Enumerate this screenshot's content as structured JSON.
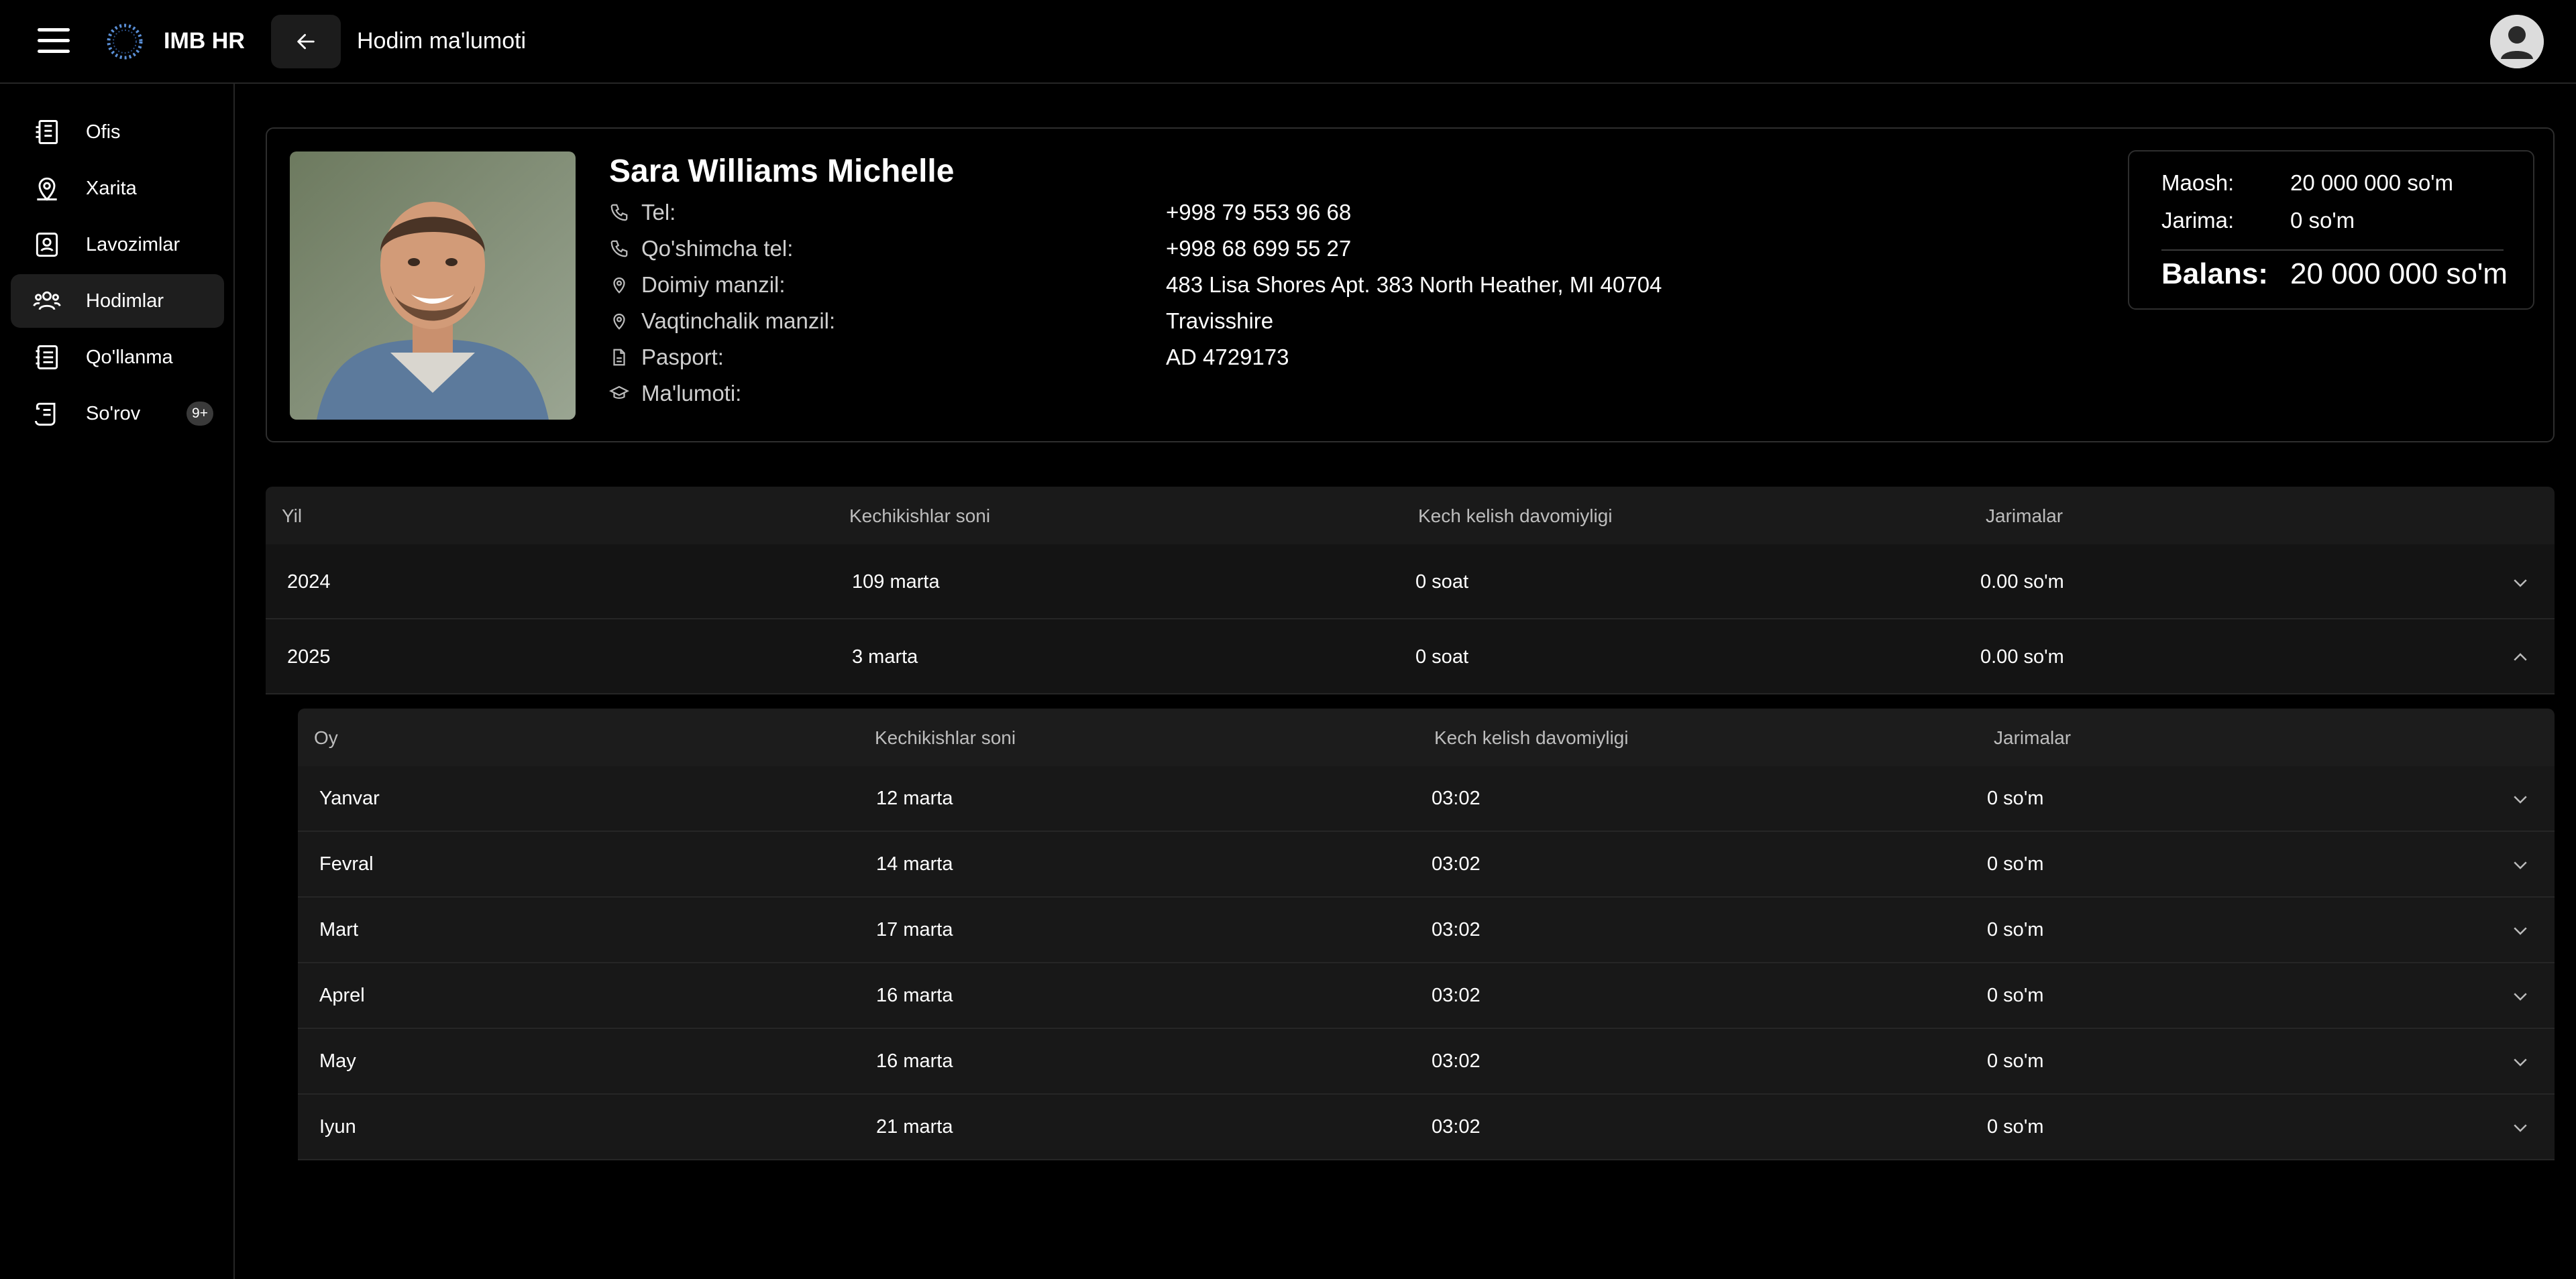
{
  "header": {
    "brand": "IMB HR",
    "page_title": "Hodim ma'lumoti"
  },
  "sidebar": {
    "items": [
      {
        "label": "Ofis",
        "icon": "office-building-icon"
      },
      {
        "label": "Xarita",
        "icon": "map-pin-icon"
      },
      {
        "label": "Lavozimlar",
        "icon": "id-badge-icon"
      },
      {
        "label": "Hodimlar",
        "icon": "users-icon",
        "active": true
      },
      {
        "label": "Qo'llanma",
        "icon": "notebook-icon"
      },
      {
        "label": "So'rov",
        "icon": "request-scroll-icon",
        "badge": "9+"
      }
    ]
  },
  "profile": {
    "name": "Sara Williams Michelle",
    "fields": [
      {
        "label": "Tel:",
        "value": "+998 79 553 96 68",
        "icon": "phone-icon"
      },
      {
        "label": "Qo'shimcha tel:",
        "value": "+998 68 699 55 27",
        "icon": "phone-icon"
      },
      {
        "label": "Doimiy manzil:",
        "value": "483 Lisa Shores Apt. 383 North Heather, MI 40704",
        "icon": "location-icon"
      },
      {
        "label": "Vaqtinchalik manzil:",
        "value": "Travisshire",
        "icon": "location-icon"
      },
      {
        "label": "Pasport:",
        "value": "AD 4729173",
        "icon": "document-icon"
      },
      {
        "label": "Ma'lumoti:",
        "value": "",
        "icon": "graduation-cap-icon"
      }
    ]
  },
  "balance": {
    "salary_label": "Maosh:",
    "salary_value": "20 000 000 so'm",
    "fine_label": "Jarima:",
    "fine_value": "0 so'm",
    "balance_label": "Balans:",
    "balance_value": "20 000 000 so'm"
  },
  "years_table": {
    "headers": [
      "Yil",
      "Kechikishlar soni",
      "Kech kelish davomiyligi",
      "Jarimalar"
    ],
    "rows": [
      {
        "year": "2024",
        "count": "109 marta",
        "duration": "0 soat",
        "fines": "0.00 so'm",
        "expanded": false
      },
      {
        "year": "2025",
        "count": "3 marta",
        "duration": "0 soat",
        "fines": "0.00 so'm",
        "expanded": true
      }
    ]
  },
  "months_table": {
    "headers": [
      "Oy",
      "Kechikishlar soni",
      "Kech kelish davomiyligi",
      "Jarimalar"
    ],
    "rows": [
      {
        "month": "Yanvar",
        "count": "12 marta",
        "duration": "03:02",
        "fines": "0 so'm"
      },
      {
        "month": "Fevral",
        "count": "14 marta",
        "duration": "03:02",
        "fines": "0 so'm"
      },
      {
        "month": "Mart",
        "count": "17 marta",
        "duration": "03:02",
        "fines": "0 so'm"
      },
      {
        "month": "Aprel",
        "count": "16 marta",
        "duration": "03:02",
        "fines": "0 so'm"
      },
      {
        "month": "May",
        "count": "16 marta",
        "duration": "03:02",
        "fines": "0 so'm"
      },
      {
        "month": "Iyun",
        "count": "21 marta",
        "duration": "03:02",
        "fines": "0 so'm"
      }
    ]
  }
}
